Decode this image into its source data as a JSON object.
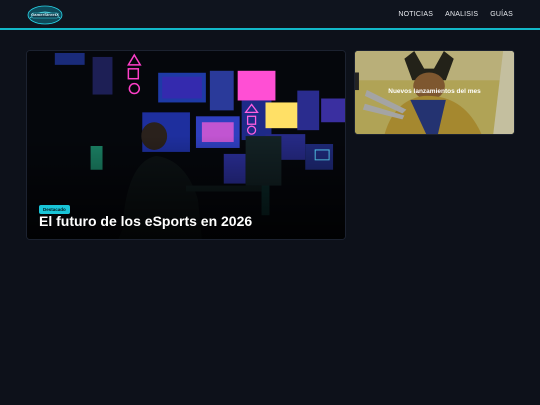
{
  "header": {
    "logo_text": "GamerStreetX",
    "nav": [
      {
        "label": "NOTICIAS"
      },
      {
        "label": "ANALISIS"
      },
      {
        "label": "GUÍAS"
      }
    ]
  },
  "featured": {
    "badge": "Destacado",
    "title": "El futuro de los eSports en 2026"
  },
  "secondary": {
    "title": "Nuevos lanzamientos del mes"
  },
  "colors": {
    "accent": "#12b8c8",
    "background": "#0d111a"
  }
}
